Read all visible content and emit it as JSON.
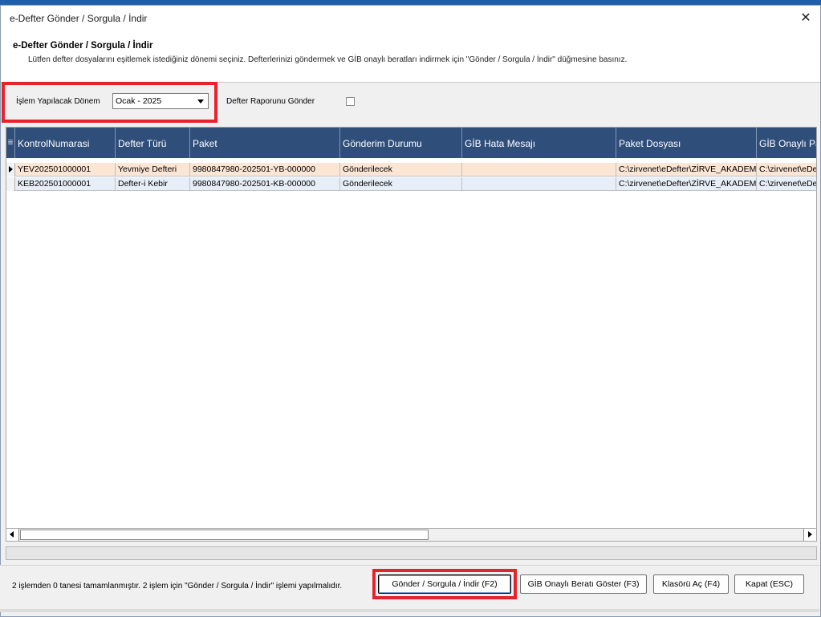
{
  "window": {
    "title": "e-Defter Gönder / Sorgula / İndir",
    "close_glyph": "✕"
  },
  "header": {
    "title": "e-Defter Gönder / Sorgula / İndir",
    "description": "Lütfen defter dosyalarını eşitlemek istediğiniz dönemi seçiniz. Defterlerinizi göndermek ve GİB onaylı beratları indirmek için \"Gönder / Sorgula / İndir\" düğmesine basınız."
  },
  "filters": {
    "period_label": "İşlem Yapılacak Dönem",
    "period_value": "Ocak - 2025",
    "report_label": "Defter Raporunu Gönder",
    "report_checked": false
  },
  "grid": {
    "columns": [
      "KontrolNumarasi",
      "Defter Türü",
      "Paket",
      "Gönderim Durumu",
      "GİB Hata Mesajı",
      "Paket Dosyası",
      "GİB Onaylı Pa"
    ],
    "rows": [
      [
        "YEV202501000001",
        "Yevmiye Defteri",
        "9980847980-202501-YB-000000",
        "Gönderilecek",
        "",
        "C:\\zirvenet\\eDefter\\ZİRVE_AKADEMİ",
        "C:\\zirvenet\\eDefter"
      ],
      [
        "KEB202501000001",
        "Defter-i Kebir",
        "9980847980-202501-KB-000000",
        "Gönderilecek",
        "",
        "C:\\zirvenet\\eDefter\\ZİRVE_AKADEMİ",
        "C:\\zirvenet\\eDefter"
      ]
    ]
  },
  "footer": {
    "status": "2 işlemden 0 tanesi tamamlanmıştır. 2 işlem için \"Gönder / Sorgula / İndir\" işlemi yapılmalıdır.",
    "buttons": {
      "send": "Gönder / Sorgula / İndir (F2)",
      "show_berat": "GİB Onaylı Beratı Göster (F3)",
      "open_folder": "Klasörü Aç (F4)",
      "close": "Kapat (ESC)"
    }
  },
  "colors": {
    "highlight": "#e8222a",
    "grid_header": "#2f4e7a",
    "selected_row": "#fbe5d4"
  }
}
